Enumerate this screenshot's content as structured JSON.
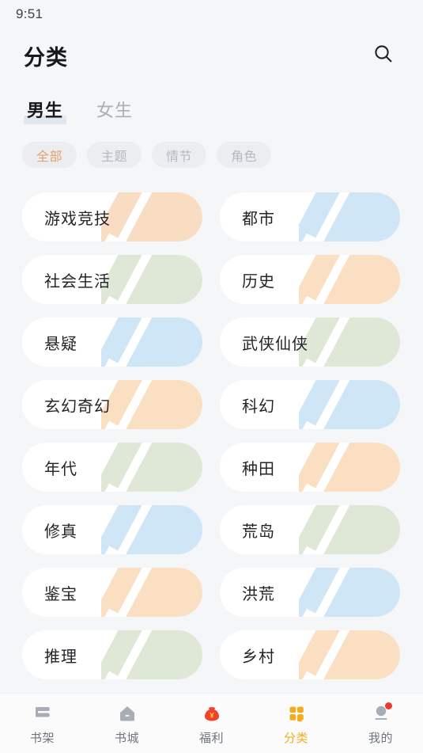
{
  "status_bar": {
    "time": "9:51"
  },
  "header": {
    "title": "分类",
    "search_icon": "search-icon"
  },
  "tabs": [
    {
      "label": "男生",
      "active": true
    },
    {
      "label": "女生",
      "active": false
    }
  ],
  "chips": [
    {
      "label": "全部",
      "active": true
    },
    {
      "label": "主题",
      "active": false
    },
    {
      "label": "情节",
      "active": false
    },
    {
      "label": "角色",
      "active": false
    }
  ],
  "categories": [
    {
      "label": "游戏竞技",
      "color": "#f9ddc3"
    },
    {
      "label": "都市",
      "color": "#cfe6f7"
    },
    {
      "label": "社会生活",
      "color": "#dfe8d6"
    },
    {
      "label": "历史",
      "color": "#fadfc3"
    },
    {
      "label": "悬疑",
      "color": "#cfe6f7"
    },
    {
      "label": "武侠仙侠",
      "color": "#dfe8d6"
    },
    {
      "label": "玄幻奇幻",
      "color": "#fadfc3"
    },
    {
      "label": "科幻",
      "color": "#cfe6f7"
    },
    {
      "label": "年代",
      "color": "#dfe8d6"
    },
    {
      "label": "种田",
      "color": "#fadfc3"
    },
    {
      "label": "修真",
      "color": "#cfe6f7"
    },
    {
      "label": "荒岛",
      "color": "#dfe8d6"
    },
    {
      "label": "鉴宝",
      "color": "#fadfc3"
    },
    {
      "label": "洪荒",
      "color": "#cfe6f7"
    },
    {
      "label": "推理",
      "color": "#dfe8d6"
    },
    {
      "label": "乡村",
      "color": "#fadfc3"
    }
  ],
  "bottom_nav": {
    "active_color": "#f2ad1e",
    "inactive_color": "#6f7480",
    "items": [
      {
        "label": "书架",
        "icon": "bookshelf-icon",
        "active": false,
        "badge": false
      },
      {
        "label": "书城",
        "icon": "home-icon",
        "active": false,
        "badge": false
      },
      {
        "label": "福利",
        "icon": "gift-bag-icon",
        "active": false,
        "badge": false
      },
      {
        "label": "分类",
        "icon": "grid-icon",
        "active": true,
        "badge": false
      },
      {
        "label": "我的",
        "icon": "user-icon",
        "active": false,
        "badge": true
      }
    ]
  }
}
